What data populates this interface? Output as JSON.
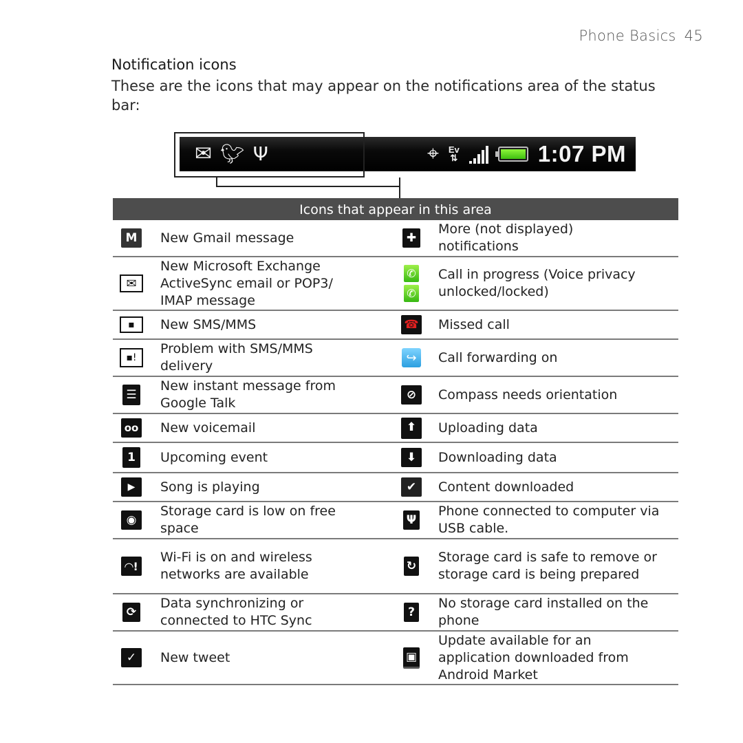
{
  "header": {
    "section": "Phone Basics",
    "page_number": "45"
  },
  "title": "Notification icons",
  "intro": "These are the icons that may appear on the notifications area of the status bar:",
  "status_bar": {
    "notification_icons": [
      "mail-icon",
      "tweet-bird-icon",
      "usb-icon"
    ],
    "status_icons": [
      "gps-icon",
      "ev-data-icon",
      "signal-icon",
      "battery-icon"
    ],
    "battery_level": 1.0,
    "signal_bars": 5,
    "network_label": "Ev",
    "time": "1:07 PM"
  },
  "table": {
    "header": "Icons that appear in this area",
    "rows": [
      {
        "left": {
          "icon": "gmail-icon",
          "label": "New Gmail message"
        },
        "right": {
          "icon": "more-notifications-icon",
          "label": "More (not displayed) notifications"
        }
      },
      {
        "left": {
          "icon": "email-icon",
          "label": "New Microsoft Exchange ActiveSync email or POP3/ IMAP message"
        },
        "right": {
          "icon": "call-in-progress-icon",
          "label": "Call in progress (Voice privacy unlocked/locked)"
        }
      },
      {
        "left": {
          "icon": "sms-icon",
          "label": "New SMS/MMS"
        },
        "right": {
          "icon": "missed-call-icon",
          "label": "Missed call"
        }
      },
      {
        "left": {
          "icon": "sms-problem-icon",
          "label": "Problem with SMS/MMS delivery"
        },
        "right": {
          "icon": "call-forwarding-icon",
          "label": "Call forwarding on"
        }
      },
      {
        "left": {
          "icon": "google-talk-icon",
          "label": "New instant message from Google Talk"
        },
        "right": {
          "icon": "compass-icon",
          "label": "Compass needs orientation"
        }
      },
      {
        "left": {
          "icon": "voicemail-icon",
          "label": "New voicemail"
        },
        "right": {
          "icon": "upload-icon",
          "label": "Uploading data"
        }
      },
      {
        "left": {
          "icon": "calendar-icon",
          "label": "Upcoming event",
          "glyph": "1"
        },
        "right": {
          "icon": "download-icon",
          "label": "Downloading data"
        }
      },
      {
        "left": {
          "icon": "play-icon",
          "label": "Song is playing"
        },
        "right": {
          "icon": "content-downloaded-icon",
          "label": "Content downloaded"
        }
      },
      {
        "left": {
          "icon": "storage-low-icon",
          "label": "Storage card is low on free space"
        },
        "right": {
          "icon": "usb-connected-icon",
          "label": "Phone connected to computer via USB cable."
        }
      },
      {
        "left": {
          "icon": "wifi-icon",
          "label": "Wi-Fi is on and wireless networks are available"
        },
        "right": {
          "icon": "storage-safe-remove-icon",
          "label": "Storage card is safe to remove or storage card is being prepared"
        }
      },
      {
        "left": {
          "icon": "sync-icon",
          "label": "Data synchronizing or connected to HTC Sync"
        },
        "right": {
          "icon": "no-storage-card-icon",
          "label": "No storage card installed on the phone"
        }
      },
      {
        "left": {
          "icon": "tweet-icon",
          "label": "New tweet"
        },
        "right": {
          "icon": "app-update-icon",
          "label": "Update available for an application downloaded from Android Market"
        }
      }
    ]
  }
}
